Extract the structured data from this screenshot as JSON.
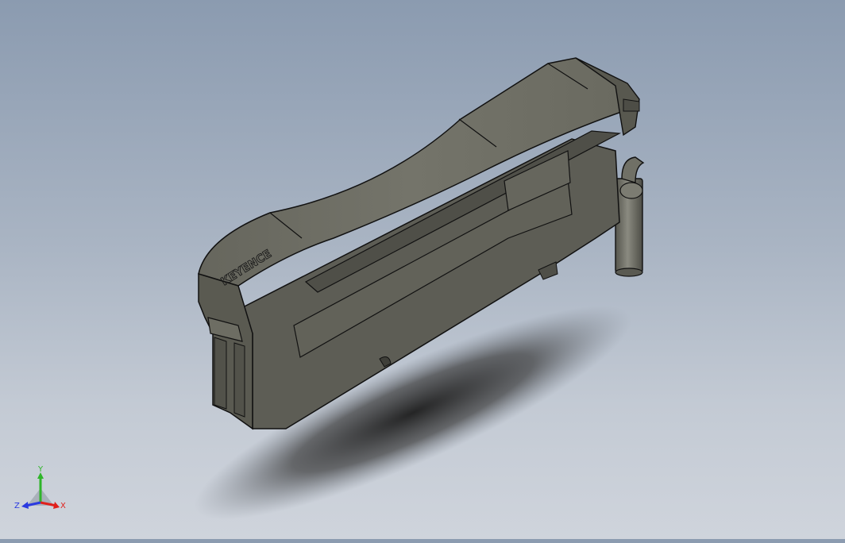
{
  "viewport": {
    "brand_logo_text": "KEYENCE"
  },
  "triad": {
    "x_label": "X",
    "y_label": "Y",
    "z_label": "Z",
    "x_color": "#e0201b",
    "y_color": "#2fb52a",
    "z_color": "#2a3ae0"
  },
  "colors": {
    "background_top": "#8b9bb0",
    "background_bottom": "#cfd4dc",
    "body_top": "#6c6c62",
    "body_side": "#5d5d55",
    "edge": "#111111"
  }
}
